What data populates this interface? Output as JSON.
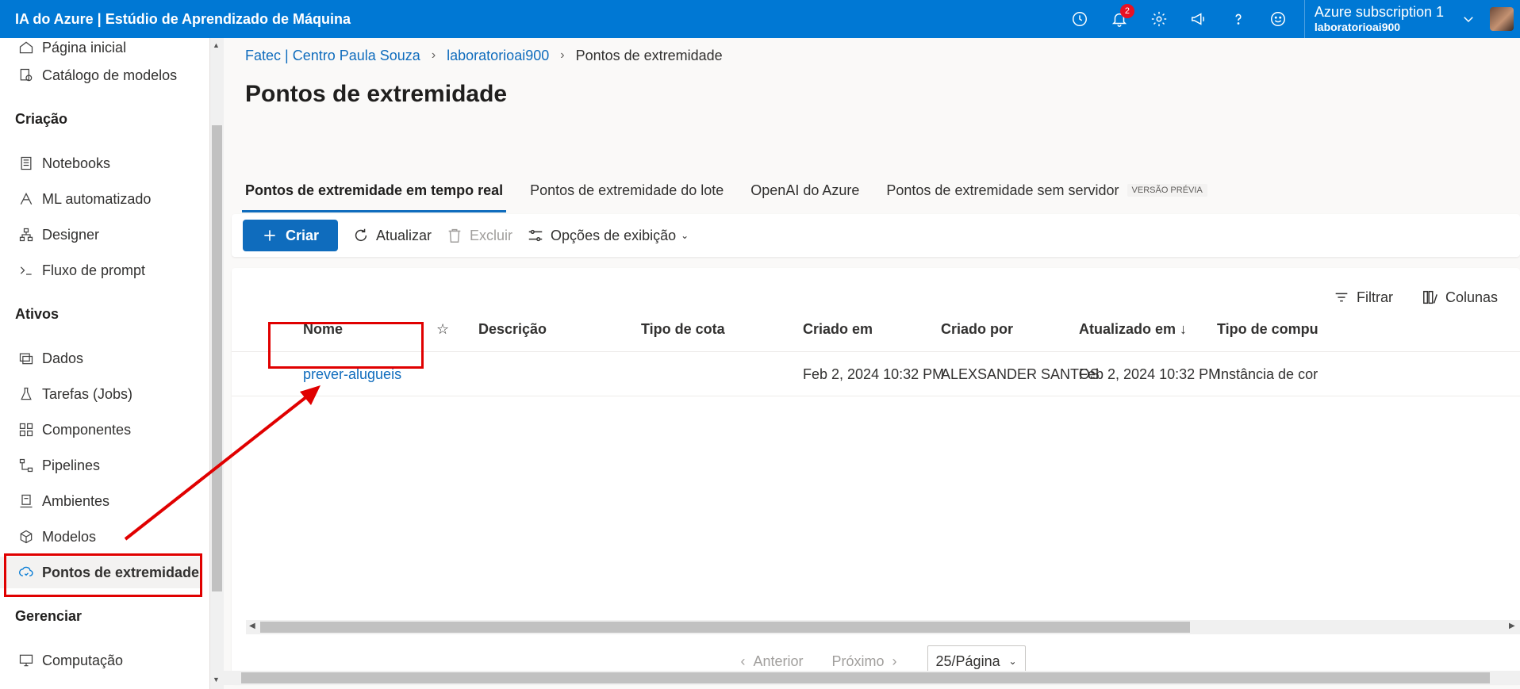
{
  "app": {
    "title": "IA do Azure | Estúdio de Aprendizado de Máquina"
  },
  "topbar": {
    "icons": [
      "history-icon",
      "notifications-icon",
      "settings-icon",
      "feedback-icon",
      "help-icon",
      "smiley-icon"
    ],
    "notification_count": "2",
    "account": {
      "subscription": "Azure subscription 1",
      "workspace": "laboratorioai900"
    }
  },
  "sidebar": {
    "items": [
      {
        "label": "Página inicial",
        "icon": "home-icon"
      },
      {
        "label": "Catálogo de modelos",
        "icon": "catalog-icon"
      },
      {
        "label": "Notebooks",
        "icon": "notebook-icon"
      },
      {
        "label": "ML automatizado",
        "icon": "automl-icon"
      },
      {
        "label": "Designer",
        "icon": "designer-icon"
      },
      {
        "label": "Fluxo de prompt",
        "icon": "prompt-icon"
      },
      {
        "label": "Dados",
        "icon": "data-icon"
      },
      {
        "label": "Tarefas (Jobs)",
        "icon": "flask-icon"
      },
      {
        "label": "Componentes",
        "icon": "components-icon"
      },
      {
        "label": "Pipelines",
        "icon": "pipeline-icon"
      },
      {
        "label": "Ambientes",
        "icon": "environment-icon"
      },
      {
        "label": "Modelos",
        "icon": "model-icon"
      },
      {
        "label": "Pontos de extremidade",
        "icon": "endpoint-icon"
      },
      {
        "label": "Computação",
        "icon": "compute-icon"
      }
    ],
    "sections": {
      "create": "Criação",
      "assets": "Ativos",
      "manage": "Gerenciar"
    },
    "active": "Pontos de extremidade"
  },
  "breadcrumb": [
    "Fatec | Centro Paula Souza",
    "laboratorioai900",
    "Pontos de extremidade"
  ],
  "page": {
    "title": "Pontos de extremidade"
  },
  "tabs": [
    {
      "label": "Pontos de extremidade em tempo real",
      "active": true
    },
    {
      "label": "Pontos de extremidade do lote"
    },
    {
      "label": "OpenAI do Azure"
    },
    {
      "label": "Pontos de extremidade sem servidor",
      "badge": "VERSÃO PRÉVIA"
    }
  ],
  "toolbar": {
    "create": "Criar",
    "refresh": "Atualizar",
    "delete": "Excluir",
    "view_options": "Opções de exibição"
  },
  "panel": {
    "filter": "Filtrar",
    "columns": "Colunas"
  },
  "table": {
    "headers": [
      "Nome",
      "Descrição",
      "Tipo de cota",
      "Criado em",
      "Criado por",
      "Atualizado em ↓",
      "Tipo de compu"
    ],
    "rows": [
      {
        "name": "prever-alugueis",
        "description": "",
        "quota_type": "",
        "created_on": "Feb 2, 2024 10:32 PM",
        "created_by": "ALEXSANDER SANTOS",
        "updated_on": "Feb 2, 2024 10:32 PM",
        "compute_type": "Instância de cor"
      }
    ]
  },
  "pager": {
    "prev": "Anterior",
    "next": "Próximo",
    "page_size": "25/Página"
  },
  "colors": {
    "brand": "#0078d4",
    "link": "#0f6cbd",
    "annotation": "#e00000"
  }
}
